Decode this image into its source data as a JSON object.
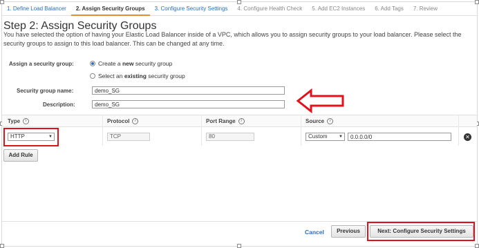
{
  "wizard": {
    "steps": [
      {
        "label": "1. Define Load Balancer"
      },
      {
        "label": "2. Assign Security Groups"
      },
      {
        "label": "3. Configure Security Settings"
      },
      {
        "label": "4. Configure Health Check"
      },
      {
        "label": "5. Add EC2 Instances"
      },
      {
        "label": "6. Add Tags"
      },
      {
        "label": "7. Review"
      }
    ]
  },
  "page": {
    "title": "Step 2: Assign Security Groups",
    "description": "You have selected the option of having your Elastic Load Balancer inside of a VPC, which allows you to assign security groups to your load balancer. Please select the security groups to assign to this load balancer. This can be changed at any time."
  },
  "assign": {
    "label": "Assign a security group:",
    "option_new_pre": "Create a ",
    "option_new_bold": "new",
    "option_new_post": " security group",
    "option_existing_pre": "Select an ",
    "option_existing_bold": "existing",
    "option_existing_post": " security group"
  },
  "form": {
    "name_label": "Security group name:",
    "name_value": "demo_SG",
    "description_label": "Description:",
    "description_value": "demo_SG"
  },
  "rules_table": {
    "headers": {
      "type": "Type",
      "protocol": "Protocol",
      "port_range": "Port Range",
      "source": "Source"
    },
    "info_glyph": "i",
    "row": {
      "type": "HTTP",
      "protocol": "TCP",
      "port_range": "80",
      "source_mode": "Custom",
      "source_cidr": "0.0.0.0/0"
    },
    "remove_glyph": "✕",
    "add_rule_label": "Add Rule"
  },
  "footer": {
    "cancel_label": "Cancel",
    "previous_label": "Previous",
    "next_label": "Next: Configure Security Settings"
  },
  "colors": {
    "link": "#2a6ebb",
    "active_tab": "#e88b2a",
    "annotation_red": "#e0101c"
  },
  "icons": [
    "info-icon",
    "remove-row-icon",
    "dropdown-caret-icon",
    "annotation-arrow-icon"
  ]
}
